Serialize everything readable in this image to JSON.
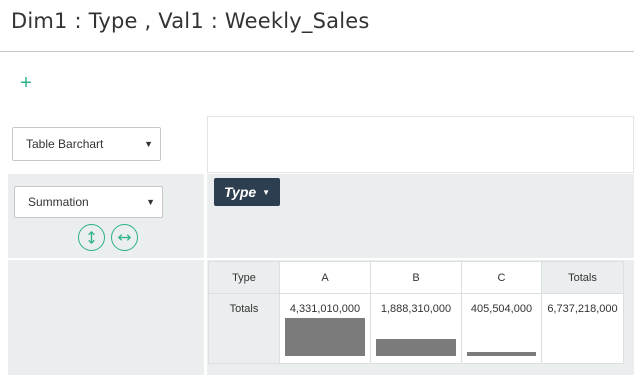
{
  "header": {
    "title": "Dim1 : Type , Val1 : Weekly_Sales"
  },
  "toolbar": {
    "add_icon_glyph": "+"
  },
  "renderer": {
    "selected": "Table Barchart",
    "caret": "▼"
  },
  "aggregator": {
    "selected": "Summation",
    "caret": "▼"
  },
  "rows_attribute": {
    "label": "Type",
    "caret": "▼"
  },
  "sort_buttons": {
    "rows_icon": "vertical-arrows-icon",
    "cols_icon": "horizontal-arrows-icon"
  },
  "table": {
    "axis_label": "Type",
    "columns": [
      "A",
      "B",
      "C"
    ],
    "totals_label": "Totals",
    "row_label": "Totals",
    "values": [
      "4,331,010,000",
      "1,888,310,000",
      "405,504,000"
    ],
    "grand_total": "6,737,218,000"
  },
  "chart_data": {
    "type": "bar",
    "categories": [
      "A",
      "B",
      "C"
    ],
    "values": [
      4331010000,
      1888310000,
      405504000
    ],
    "bar_color": "#7b7b7b"
  },
  "colors": {
    "accent": "#2bb18a",
    "pill_bg": "#2c3e50",
    "panel_bg": "#ebeeee"
  }
}
